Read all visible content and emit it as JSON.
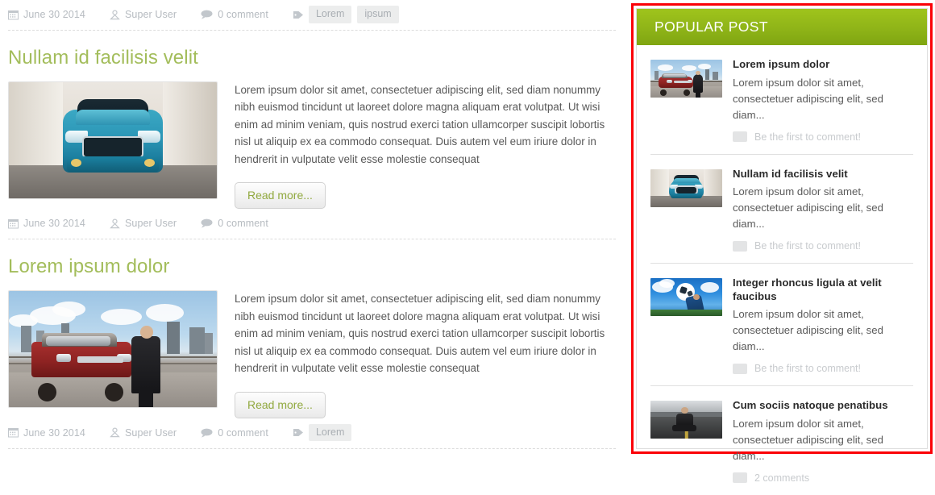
{
  "main": {
    "top_meta": {
      "date": "June 30 2014",
      "author": "Super User",
      "comments": "0 comment",
      "tags": [
        "Lorem",
        "ipsum"
      ]
    },
    "articles": [
      {
        "title": "Nullam id facilisis velit",
        "image_name": "teal-suv-photo",
        "text": "Lorem ipsum dolor sit amet, consectetuer adipiscing elit, sed diam nonummy nibh euismod tincidunt ut laoreet dolore magna aliquam erat volutpat. Ut wisi enim ad minim veniam, quis nostrud exerci tation ullamcorper suscipit lobortis nisl ut aliquip ex ea commodo consequat. Duis autem vel eum iriure dolor in hendrerit in vulputate velit esse molestie consequat",
        "read_more": "Read more...",
        "meta": {
          "date": "June 30 2014",
          "author": "Super User",
          "comments": "0 comment",
          "tags": []
        }
      },
      {
        "title": "Lorem ipsum dolor",
        "image_name": "red-range-rover-photo",
        "text": "Lorem ipsum dolor sit amet, consectetuer adipiscing elit, sed diam nonummy nibh euismod tincidunt ut laoreet dolore magna aliquam erat volutpat. Ut wisi enim ad minim veniam, quis nostrud exerci tation ullamcorper suscipit lobortis nisl ut aliquip ex ea commodo consequat. Duis autem vel eum iriure dolor in hendrerit in vulputate velit esse molestie consequat",
        "read_more": "Read more...",
        "meta": {
          "date": "June 30 2014",
          "author": "Super User",
          "comments": "0 comment",
          "tags": [
            "Lorem"
          ]
        }
      }
    ]
  },
  "sidebar": {
    "widget_title": "POPULAR POST",
    "posts": [
      {
        "title": "Lorem ipsum dolor",
        "excerpt": "Lorem ipsum dolor sit amet, consectetuer adipiscing elit, sed diam...",
        "comment_label": "Be the first to comment!",
        "thumb_name": "red-range-rover-thumb"
      },
      {
        "title": "Nullam id facilisis velit",
        "excerpt": "Lorem ipsum dolor sit amet, consectetuer adipiscing elit, sed diam...",
        "comment_label": "Be the first to comment!",
        "thumb_name": "teal-suv-thumb"
      },
      {
        "title": "Integer rhoncus ligula at velit faucibus",
        "excerpt": "Lorem ipsum dolor sit amet, consectetuer adipiscing elit, sed diam...",
        "comment_label": "Be the first to comment!",
        "thumb_name": "soccer-sky-thumb"
      },
      {
        "title": "Cum sociis natoque penatibus",
        "excerpt": "Lorem ipsum dolor sit amet, consectetuer adipiscing elit, sed diam...",
        "comment_label": "2 comments",
        "thumb_name": "man-on-road-thumb"
      }
    ]
  },
  "colors": {
    "accent_green": "#8fb418",
    "title_green": "#a3bd5b",
    "annotation_red": "#fb0007",
    "meta_gray": "#b6bbc0",
    "tag_bg": "#eceded"
  }
}
